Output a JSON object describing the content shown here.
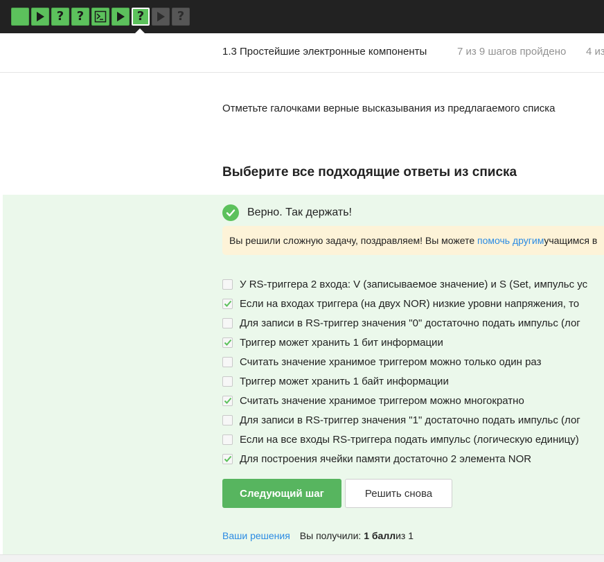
{
  "colors": {
    "accent": "#5cc15c",
    "topbar": "#222222",
    "success_bg": "#ebf8eb",
    "notice_bg": "#fdf3d8",
    "link": "#2b8be3"
  },
  "steps": [
    {
      "icon": "blank-icon",
      "state": "done"
    },
    {
      "icon": "play-icon",
      "state": "done"
    },
    {
      "icon": "question-icon",
      "state": "done"
    },
    {
      "icon": "question-icon",
      "state": "done"
    },
    {
      "icon": "terminal-icon",
      "state": "done"
    },
    {
      "icon": "play-icon",
      "state": "done"
    },
    {
      "icon": "question-icon",
      "state": "current"
    },
    {
      "icon": "play-icon",
      "state": "todo"
    },
    {
      "icon": "question-icon",
      "state": "todo"
    }
  ],
  "lesson": {
    "title": "1.3 Простейшие электронные компоненты",
    "progress": "7 из 9 шагов пройдено",
    "extra": "4 из"
  },
  "prompt": "Отметьте галочками верные высказывания из предлагаемого списка",
  "heading": "Выберите все подходящие ответы из списка",
  "verdict": {
    "text": "Верно. Так держать!",
    "icon": "checkmark-icon"
  },
  "notice": {
    "before": "Вы решили сложную задачу, поздравляем! Вы можете ",
    "link": "помочь другим",
    "after": " учащимся в"
  },
  "options": [
    {
      "label": "У RS-триггера 2 входа: V (записываемое значение) и S (Set, импульс ус",
      "checked": false
    },
    {
      "label": "Если на входах триггера (на двух NOR) низкие уровни напряжения, то",
      "checked": true
    },
    {
      "label": "Для записи в RS-триггер значения \"0\" достаточно подать импульс (лог",
      "checked": false
    },
    {
      "label": "Триггер может хранить 1 бит информации",
      "checked": true
    },
    {
      "label": "Считать значение хранимое триггером можно только один раз",
      "checked": false
    },
    {
      "label": "Триггер может хранить 1 байт информации",
      "checked": false
    },
    {
      "label": "Считать значение хранимое триггером можно многократно",
      "checked": true
    },
    {
      "label": "Для записи в RS-триггер значения \"1\" достаточно подать импульс (лог",
      "checked": false
    },
    {
      "label": "Если на все входы RS-триггера подать импульс (логическую единицу)",
      "checked": false
    },
    {
      "label": "Для построения ячейки памяти достаточно 2 элемента NOR",
      "checked": true
    }
  ],
  "buttons": {
    "next": "Следующий шаг",
    "retry": "Решить снова"
  },
  "footer": {
    "solutions_link": "Ваши решения",
    "score_prefix": "Вы получили: ",
    "score_value": "1 балл",
    "score_suffix": " из 1"
  }
}
